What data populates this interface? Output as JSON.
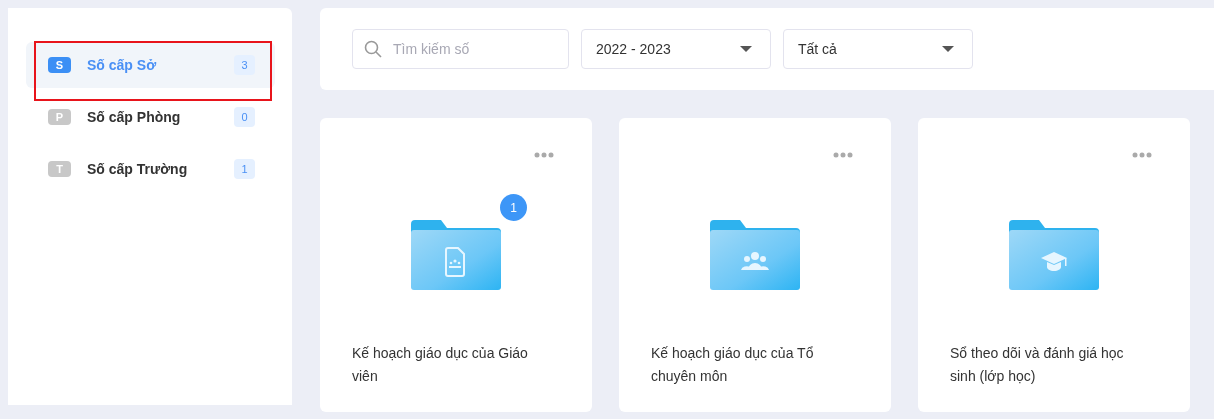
{
  "sidebar": {
    "items": [
      {
        "letter": "S",
        "label": "Số cấp Sở",
        "count": "3",
        "selected": true,
        "annotated": true
      },
      {
        "letter": "P",
        "label": "Số cấp Phòng",
        "count": "0",
        "selected": false,
        "annotated": false
      },
      {
        "letter": "T",
        "label": "Số cấp Trường",
        "count": "1",
        "selected": false,
        "annotated": false
      }
    ]
  },
  "filters": {
    "search": {
      "placeholder": "Tìm kiếm số"
    },
    "selects": [
      "2022 - 2023",
      "Tất cả"
    ]
  },
  "cards": [
    {
      "kind": "document",
      "title": "Kế hoạch giáo dục của Giáo viên",
      "badge": "1"
    },
    {
      "kind": "people",
      "title": "Kế hoạch giáo dục của Tổ chuyên môn"
    },
    {
      "kind": "cap",
      "title": "Sổ theo dõi và đánh giá học sinh (lớp học)"
    }
  ]
}
